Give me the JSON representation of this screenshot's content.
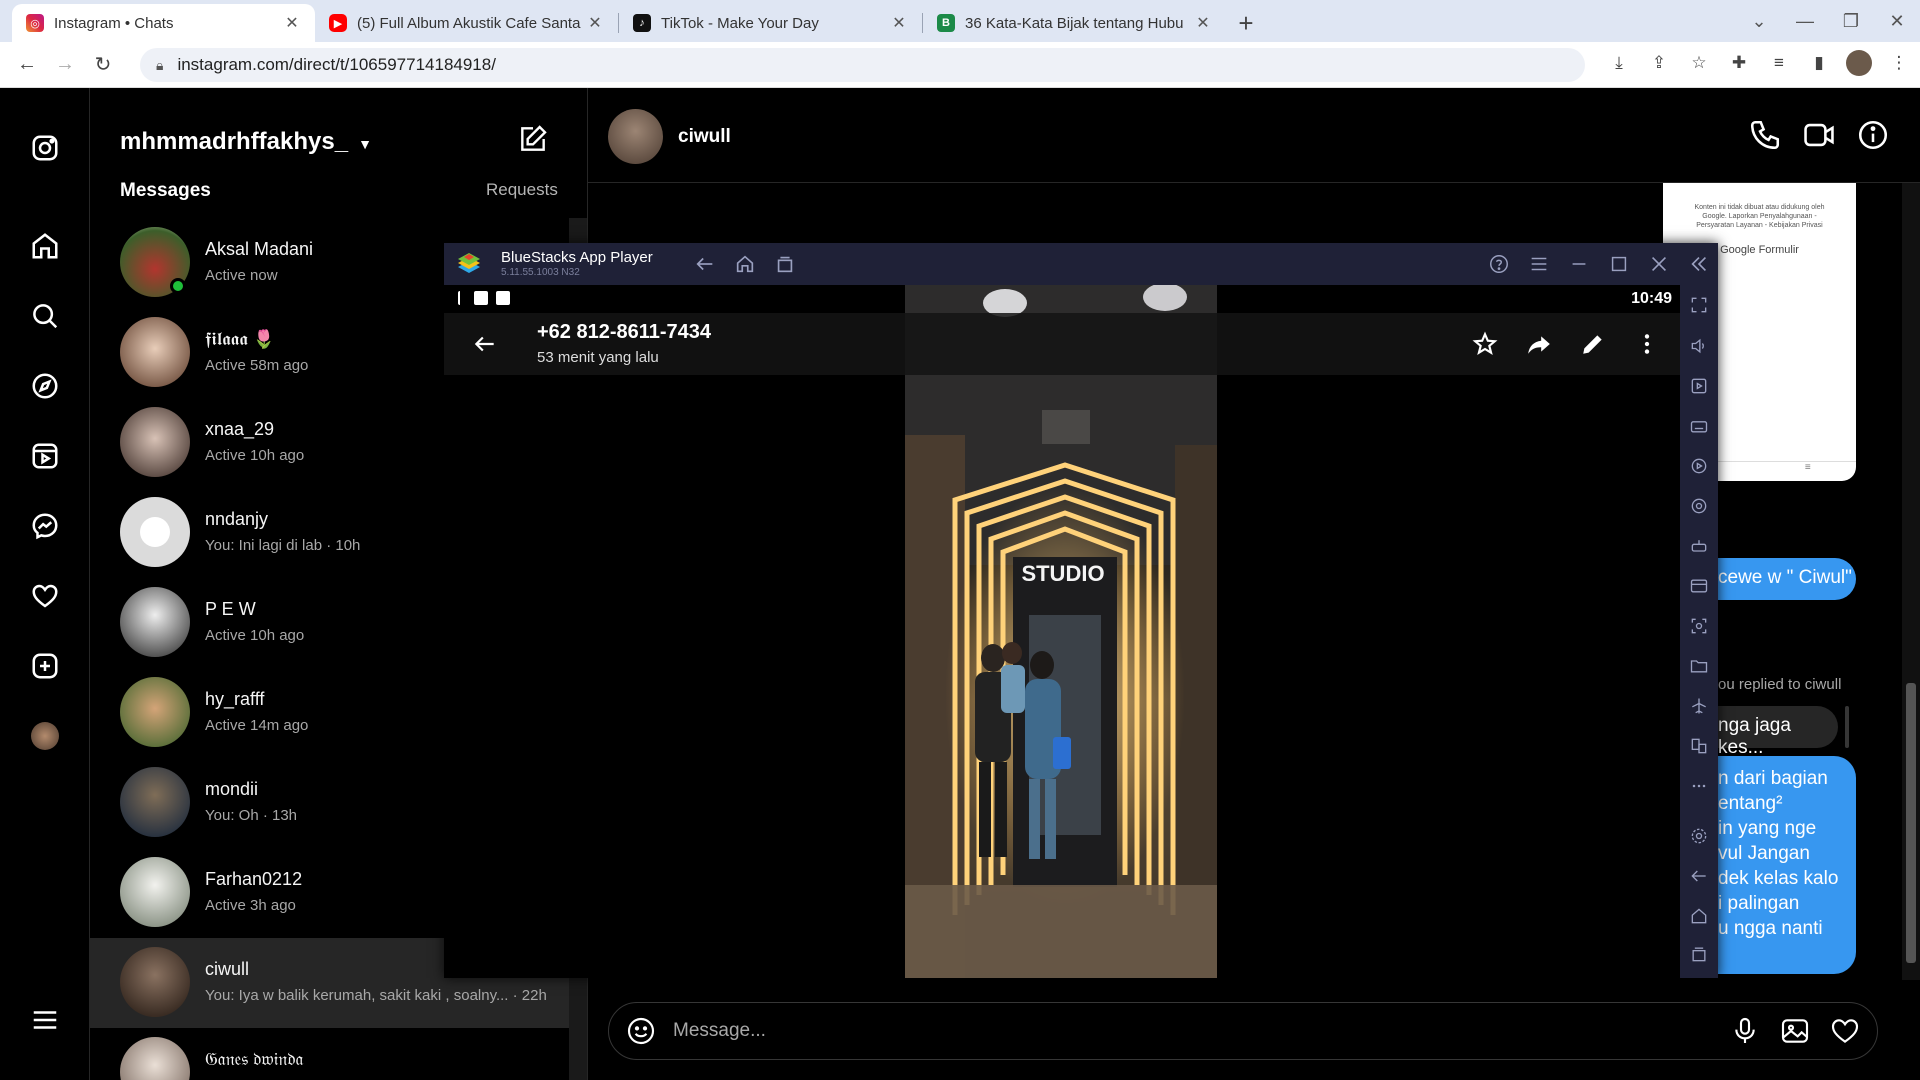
{
  "browser": {
    "tabs": [
      {
        "title": "Instagram • Chats",
        "favicon_color": "#d6249f"
      },
      {
        "title": "(5) Full Album Akustik Cafe Santa",
        "favicon_color": "#ff0000"
      },
      {
        "title": "TikTok - Make Your Day",
        "favicon_color": "#111111"
      },
      {
        "title": "36 Kata-Kata Bijak tentang Hubu",
        "favicon_color": "#1c8a48"
      }
    ],
    "url": "instagram.com/direct/t/106597714184918/"
  },
  "instagram": {
    "username": "mhmmadrhffakhys_",
    "messages_heading": "Messages",
    "requests_label": "Requests",
    "chats": [
      {
        "name": "Aksal Madani",
        "sub": "Active now",
        "online": true,
        "avatar_color": "#5a7a3b"
      },
      {
        "name": "𝖋𝖎𝖑𝖆𝖆𝖆 🌷",
        "sub": "Active 58m ago",
        "online": false,
        "avatar_color": "#c9a690"
      },
      {
        "name": "xnaa_29",
        "sub": "Active 10h ago",
        "online": false,
        "avatar_color": "#a58f84"
      },
      {
        "name": "nndanjy",
        "sub": "You: Ini lagi di lab · 10h",
        "online": false,
        "avatar_color": "#dbdbdb"
      },
      {
        "name": "P E W",
        "sub": "Active 10h ago",
        "online": false,
        "avatar_color": "#8a8a8a"
      },
      {
        "name": "hy_rafff",
        "sub": "Active 14m ago",
        "online": false,
        "avatar_color": "#9a7a55"
      },
      {
        "name": "mondii",
        "sub": "You: Oh · 13h",
        "online": false,
        "avatar_color": "#3f4650"
      },
      {
        "name": "Farhan0212",
        "sub": "Active 3h ago",
        "online": false,
        "avatar_color": "#b7b9b0"
      },
      {
        "name": "ciwull",
        "sub": "You: Iya w balik kerumah, sakit kaki , soalny... · 22h",
        "online": false,
        "avatar_color": "#5e4a3c"
      },
      {
        "name": "𝔊𝔞𝔫𝔢𝔰 𝔡𝔴𝔦𝔫𝔡𝔞",
        "sub": "",
        "online": false,
        "avatar_color": "#c2b2a6"
      }
    ],
    "conversation": {
      "name": "ciwull",
      "bubble1": "cewe w \" Ciwul\"",
      "replied_label": "ou replied to ciwull",
      "reply_bubble": "nga jaga kes...",
      "long_lines": [
        "n dari bagian",
        "entang²",
        "in yang nge",
        "vul Jangan",
        "dek kelas kalo",
        "i palingan",
        "u ngga nanti"
      ],
      "preview_text": "Konten ini tidak dibuat atau didukung oleh Google. Laporkan Penyalahgunaan - Persyaratan Layanan - Kebijakan Privasi",
      "preview_brand": "Google Formulir",
      "input_placeholder": "Message..."
    }
  },
  "bluestacks": {
    "title": "BlueStacks App Player",
    "version": "5.11.55.1003  N32",
    "status_time": "10:49",
    "viewer": {
      "phone": "+62 812-8611-7434",
      "time_ago": "53 menit yang lalu"
    },
    "photo_sign": "STUDIO"
  }
}
